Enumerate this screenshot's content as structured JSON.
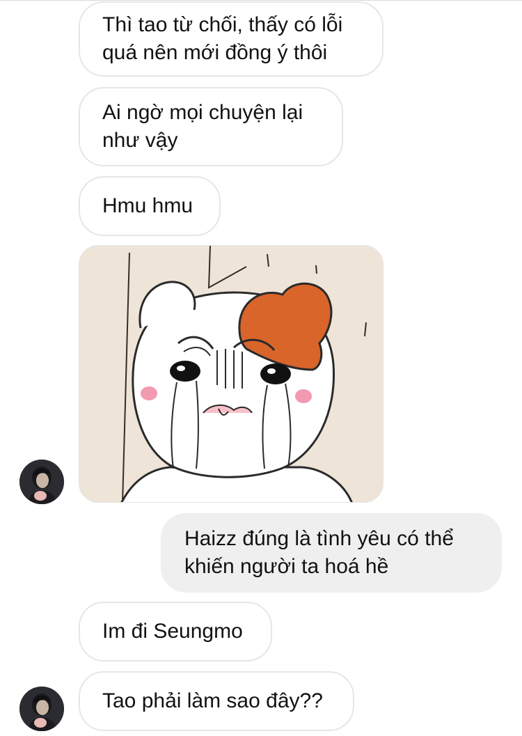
{
  "conversation": {
    "received": [
      {
        "id": "msg1",
        "text": "Thì tao từ chối, thấy có lỗi\nquá nên mới đồng ý thôi"
      },
      {
        "id": "msg2",
        "text": "Ai ngờ mọi chuyện lại\nnhư vậy"
      },
      {
        "id": "msg3",
        "text": "Hmu hmu"
      },
      {
        "id": "msg5",
        "text": "Im đi Seungmo"
      },
      {
        "id": "msg6",
        "text": "Tao phải làm sao đây??"
      }
    ],
    "sent": [
      {
        "id": "msg4",
        "text": "Haizz đúng là tình yêu có thể\nkhiến người ta hoá hề"
      }
    ],
    "sticker": {
      "icon": "crying-hamster-sticker"
    }
  },
  "colors": {
    "received_bubble_bg": "#ffffff",
    "received_bubble_border": "#e6e6e6",
    "sent_bubble_bg": "#efefef",
    "sticker_bg": "#eee4d8",
    "hamster_patch": "#d9652a",
    "cheek": "#f29ab0"
  }
}
